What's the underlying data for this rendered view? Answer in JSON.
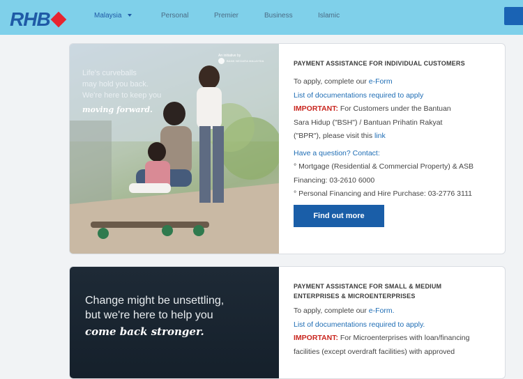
{
  "brand": {
    "logo_text": "RHB"
  },
  "nav": {
    "country": "Malaysia",
    "items": [
      "Personal",
      "Premier",
      "Business",
      "Islamic"
    ]
  },
  "cards": [
    {
      "image": {
        "badge_prefix": "An initiative by",
        "badge_name": "BANK NEGARA MALAYSIA",
        "tagline_lines": [
          "Life's curveballs",
          "may hold you back.",
          "We're here to keep you"
        ],
        "tagline_script": "moving forward."
      },
      "title": "PAYMENT ASSISTANCE FOR INDIVIDUAL CUSTOMERS",
      "apply_text": "To apply, complete our ",
      "apply_link": "e-Form",
      "docs_link": "List of documentations required to apply",
      "important_label": "IMPORTANT:",
      "important_line1": " For Customers under the Bantuan",
      "important_line2": "Sara Hidup (\"BSH\") / Bantuan Prihatin Rakyat",
      "important_line3": "(\"BPR\"), please visit this ",
      "important_link": "link",
      "question": "Have a question? Contact:",
      "contact1_line1": "° Mortgage (Residential & Commercial Property) & ASB",
      "contact1_line2": "Financing: 03-2610 6000",
      "contact2": "° Personal Financing and Hire Purchase: 03-2776 3111",
      "cta": "Find out more"
    },
    {
      "image": {
        "tagline_lines": [
          "Change might be unsettling,",
          "but we're here to help you"
        ],
        "tagline_script": "come back stronger."
      },
      "title_line1": "PAYMENT ASSISTANCE FOR SMALL & MEDIUM",
      "title_line2": "ENTERPRISES & MICROENTERPRISES",
      "apply_text": "To apply, complete our ",
      "apply_link": "e-Form.",
      "docs_link": "List of documentations required to apply.",
      "important_label": "IMPORTANT:",
      "important_line1": " For Microenterprises with loan/financing",
      "important_line2": "facilities (except overdraft facilities) with approved"
    }
  ],
  "colors": {
    "header_bg": "#7fd0ea",
    "brand_blue": "#1f5aa6",
    "brand_red": "#e7242f",
    "link": "#1d6cb4",
    "important": "#c9261f",
    "cta_bg": "#1a5ea8"
  }
}
